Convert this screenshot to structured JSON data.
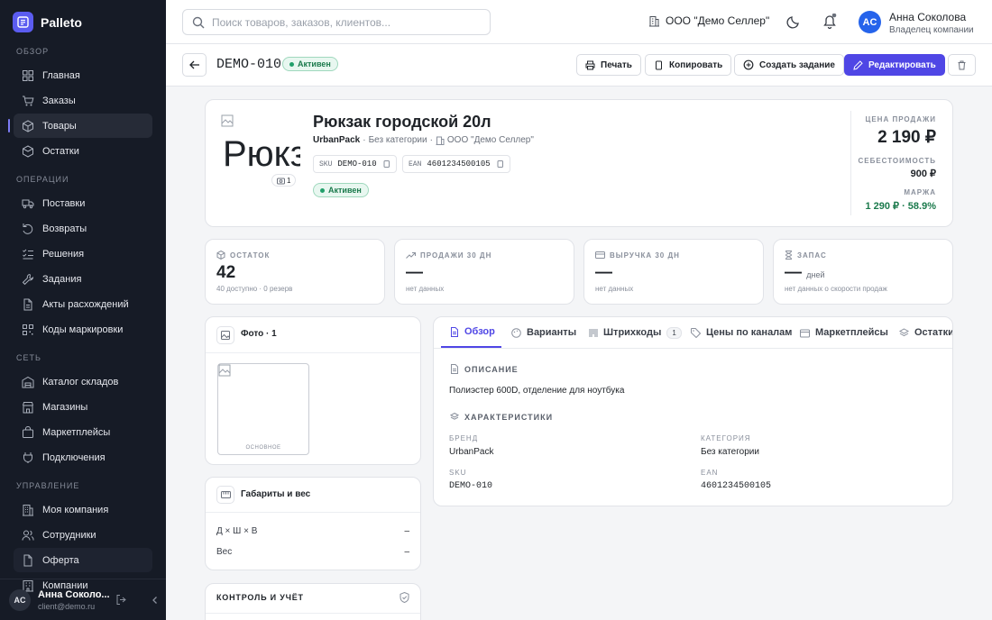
{
  "app": {
    "name": "Palleto"
  },
  "sidebar": {
    "sections": [
      {
        "title": "ОБЗОР",
        "items": [
          "Главная",
          "Заказы",
          "Товары",
          "Остатки"
        ]
      },
      {
        "title": "ОПЕРАЦИИ",
        "items": [
          "Поставки",
          "Возвраты",
          "Решения",
          "Задания",
          "Акты расхождений",
          "Коды маркировки"
        ]
      },
      {
        "title": "СЕТЬ",
        "items": [
          "Каталог складов",
          "Магазины",
          "Маркетплейсы",
          "Подключения"
        ]
      },
      {
        "title": "УПРАВЛЕНИЕ",
        "items": [
          "Моя компания",
          "Сотрудники",
          "Оферта",
          "Компании"
        ]
      }
    ],
    "active_item": "Товары",
    "user": {
      "initials": "AC",
      "name": "Анна Соколо...",
      "email": "client@demo.ru"
    }
  },
  "header": {
    "search_placeholder": "Поиск товаров, заказов, клиентов...",
    "company": "ООО \"Демо Селлер\"",
    "user": {
      "initials": "AC",
      "name": "Анна Соколова",
      "role": "Владелец компании"
    }
  },
  "toolbar": {
    "sku": "DEMO-010",
    "status": "Активен",
    "print": "Печать",
    "copy": "Копировать",
    "create_task": "Создать задание",
    "edit": "Редактировать"
  },
  "product": {
    "image_alt": "Рюкз",
    "photo_count": "1",
    "title": "Рюкзак городской 20л",
    "brand": "UrbanPack",
    "category": "Без категории",
    "company": "ООО \"Демо Селлер\"",
    "sku_label": "SKU",
    "sku": "DEMO-010",
    "ean_label": "EAN",
    "ean": "4601234500105",
    "status": "Активен",
    "sale_price_label": "ЦЕНА ПРОДАЖИ",
    "sale_price": "2 190 ₽",
    "cost_label": "СЕБЕСТОИМОСТЬ",
    "cost": "900 ₽",
    "margin_label": "МАРЖА",
    "margin": "1 290 ₽ · 58.9%"
  },
  "stats": [
    {
      "label": "ОСТАТОК",
      "value": "42",
      "unit": "",
      "sub": "40 доступно · 0 резерв"
    },
    {
      "label": "ПРОДАЖИ 30 ДН",
      "value": "—",
      "unit": "",
      "sub": "нет данных"
    },
    {
      "label": "ВЫРУЧКА 30 ДН",
      "value": "—",
      "unit": "",
      "sub": "нет данных"
    },
    {
      "label": "ЗАПАС",
      "value": "—",
      "unit": "дней",
      "sub": "нет данных о скорости продаж"
    }
  ],
  "photos": {
    "title": "Фото · 1",
    "main_label": "ОСНОВНОЕ"
  },
  "dims": {
    "title": "Габариты и вес",
    "rows": [
      {
        "label": "Д × Ш × В",
        "value": "–"
      },
      {
        "label": "Вес",
        "value": "–"
      }
    ]
  },
  "control": {
    "title": "КОНТРОЛЬ И УЧЁТ"
  },
  "tabs": [
    {
      "label": "Обзор",
      "count": ""
    },
    {
      "label": "Варианты",
      "count": ""
    },
    {
      "label": "Штрихкоды",
      "count": "1"
    },
    {
      "label": "Цены по каналам",
      "count": ""
    },
    {
      "label": "Маркетплейсы",
      "count": ""
    },
    {
      "label": "Остатки",
      "count": ""
    }
  ],
  "overview": {
    "desc_title": "ОПИСАНИЕ",
    "desc": "Полиэстер 600D, отделение для ноутбука",
    "chars_title": "ХАРАКТЕРИСТИКИ",
    "fields": [
      {
        "label": "БРЕНД",
        "value": "UrbanPack"
      },
      {
        "label": "КАТЕГОРИЯ",
        "value": "Без категории"
      },
      {
        "label": "SKU",
        "value": "DEMO-010"
      },
      {
        "label": "EAN",
        "value": "4601234500105"
      }
    ]
  }
}
